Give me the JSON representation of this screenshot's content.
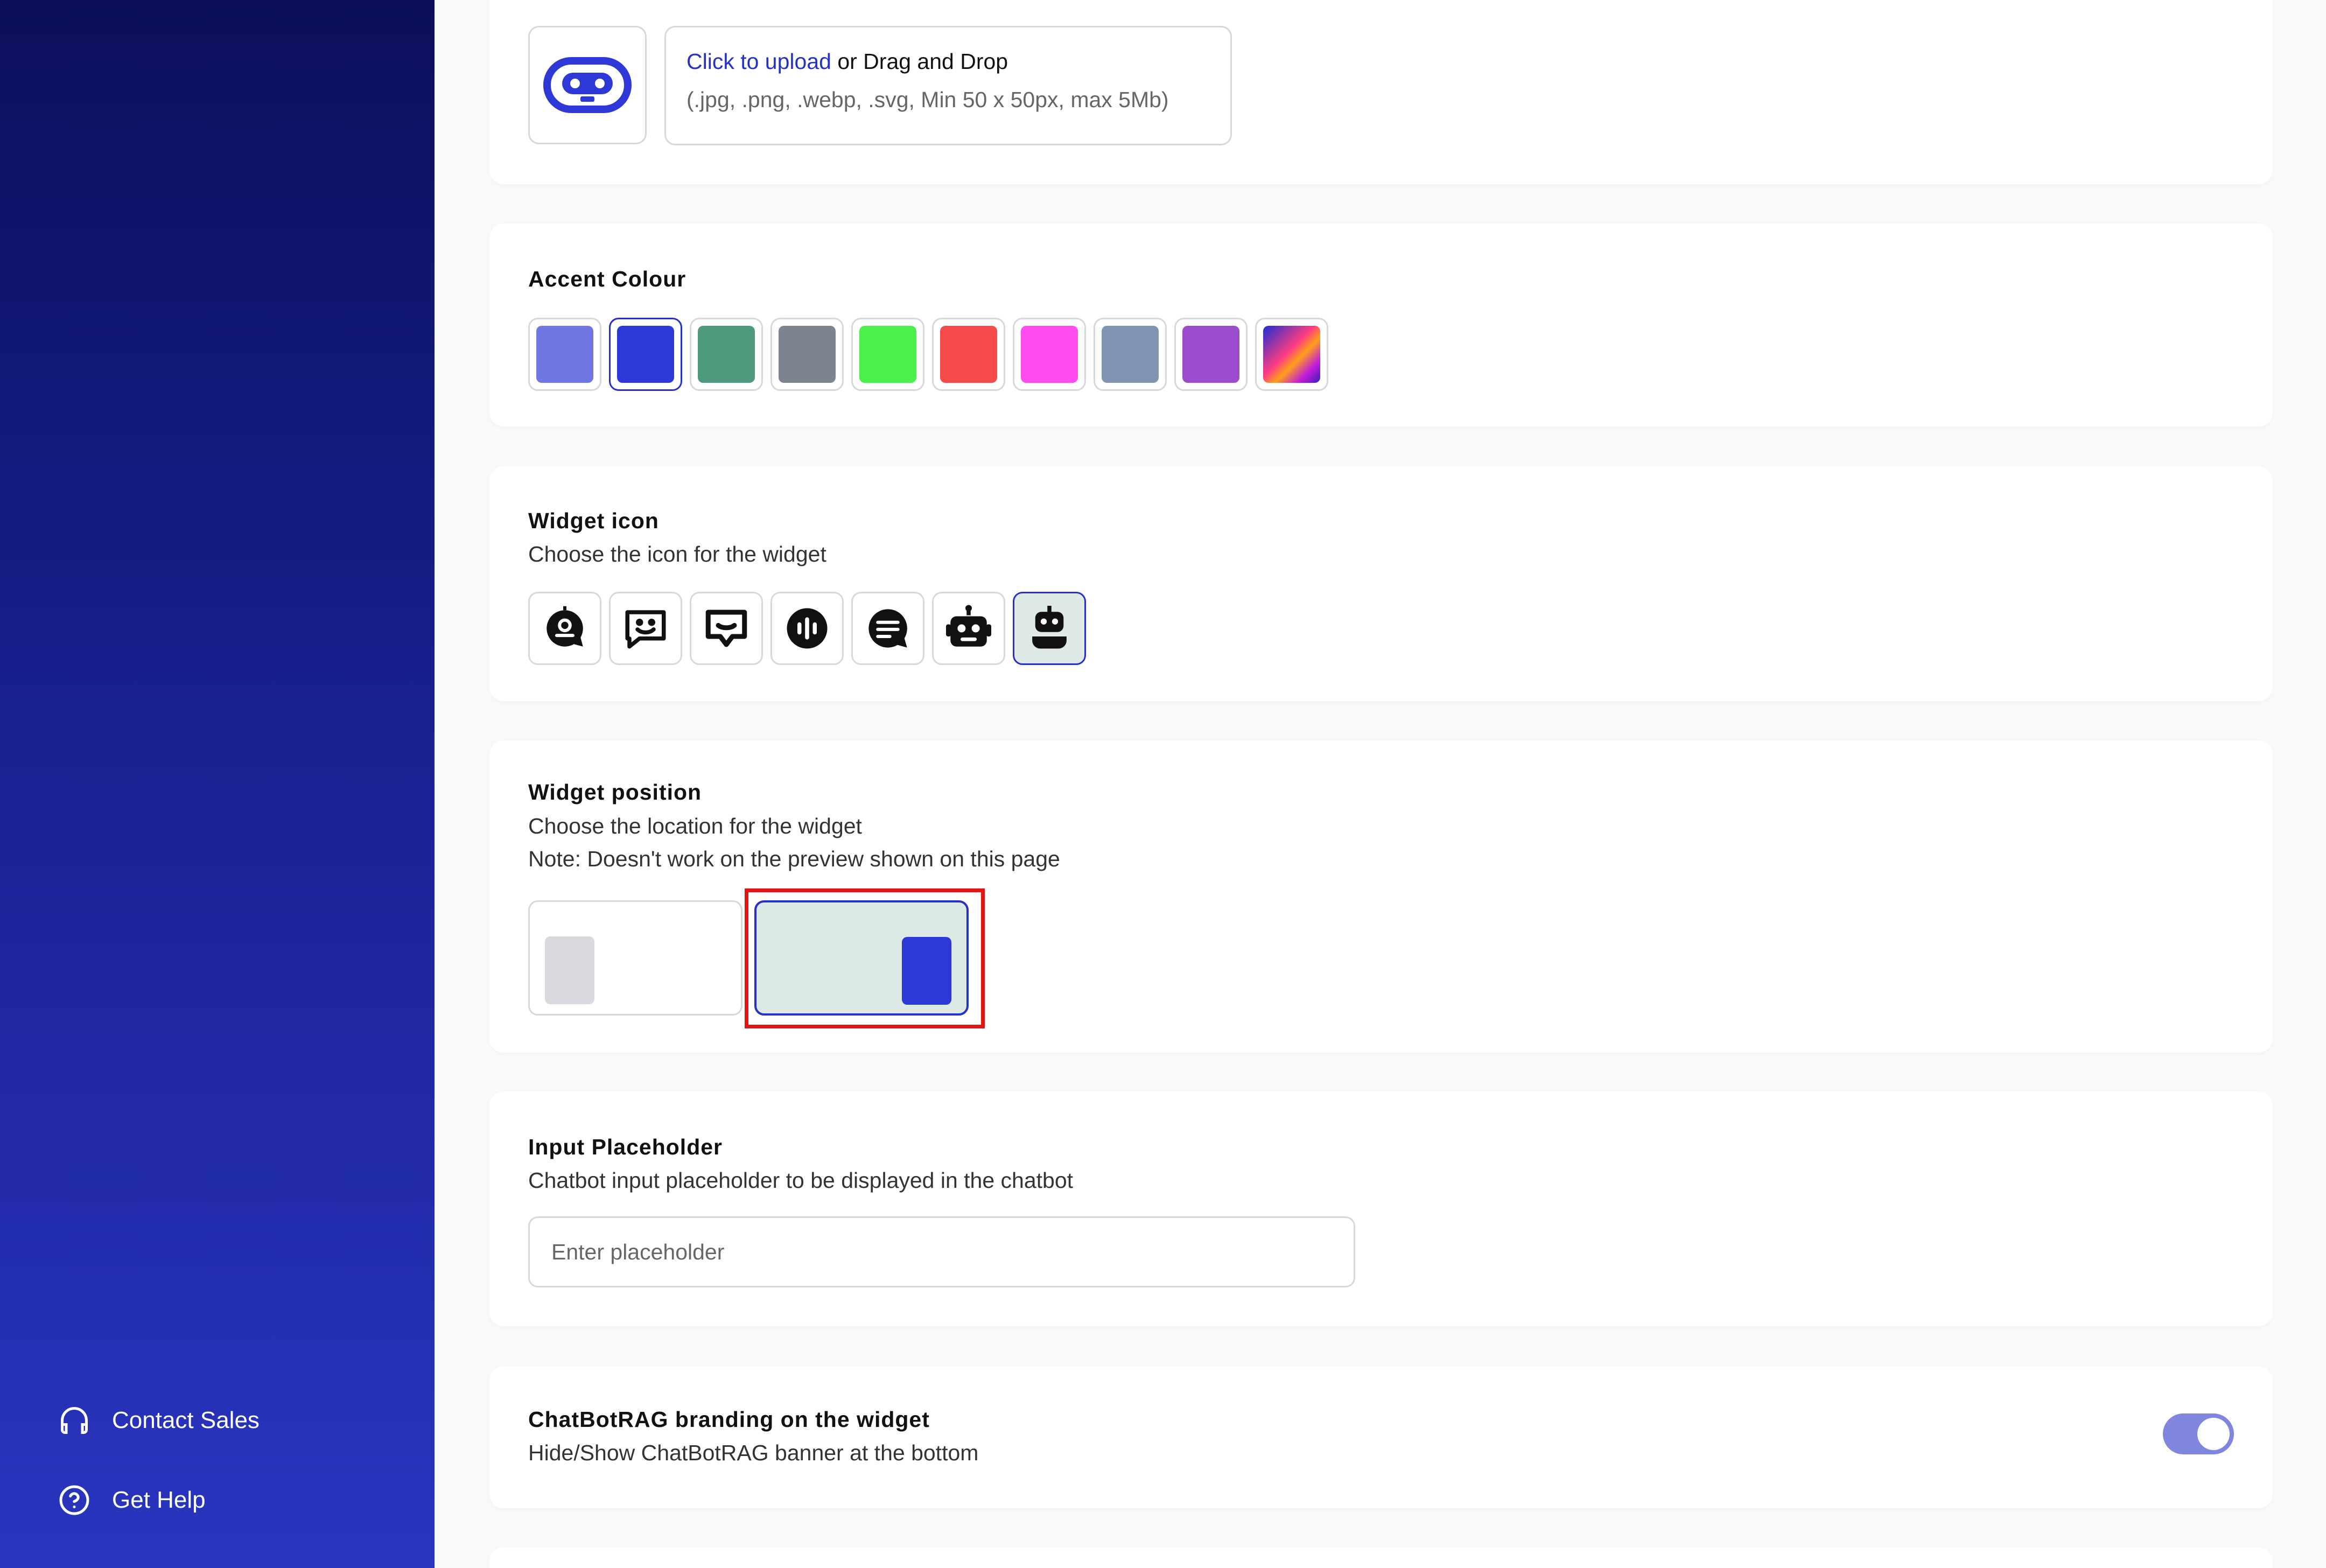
{
  "sidebar": {
    "contact_sales": "Contact Sales",
    "get_help": "Get Help"
  },
  "upload": {
    "link_text": "Click to upload",
    "rest_text": " or Drag and Drop",
    "hint": "(.jpg, .png, .webp, .svg, Min 50 x 50px, max 5Mb)"
  },
  "accent": {
    "title": "Accent Colour",
    "selected_index": 1,
    "colors": [
      "#7077e2",
      "#2e38d6",
      "#4f9a7c",
      "#7c8490",
      "#4cf04c",
      "#f54b4b",
      "#ff4cf0",
      "#7f93b3",
      "#9b4ccc",
      "gradient"
    ]
  },
  "widget_icon": {
    "title": "Widget icon",
    "subtitle": "Choose the icon for the widget",
    "icons": [
      "chat-bubble-face-icon",
      "chat-smile-icon",
      "chat-box-icon",
      "audio-wave-icon",
      "chat-lines-icon",
      "robot-icon",
      "robot-head-icon"
    ],
    "selected_index": 6
  },
  "widget_position": {
    "title": "Widget position",
    "subtitle": "Choose the location for the widget",
    "note": "Note: Doesn't work on the preview shown on this page",
    "options": [
      "left",
      "right"
    ],
    "selected": "right"
  },
  "input_placeholder": {
    "title": "Input Placeholder",
    "subtitle": "Chatbot input placeholder to be displayed in the chatbot",
    "placeholder": "Enter placeholder",
    "value": ""
  },
  "branding": {
    "title": "ChatBotRAG branding on the widget",
    "subtitle": "Hide/Show ChatBotRAG banner at the bottom",
    "enabled": true
  }
}
